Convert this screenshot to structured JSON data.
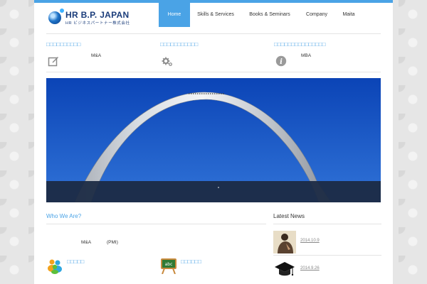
{
  "header": {
    "logo_title": "HR B.P. JAPAN",
    "logo_subtitle": "HR ビジネスパートナー株式会社",
    "accent_color": "#4aa3e6"
  },
  "nav": {
    "items": [
      {
        "label": "Home",
        "active": true
      },
      {
        "label": "Skills & Services",
        "active": false
      },
      {
        "label": "Books & Seminars",
        "active": false
      },
      {
        "label": "Company",
        "active": false
      },
      {
        "label": "Maita",
        "active": false
      }
    ]
  },
  "features": [
    {
      "title": "□□□□□□□□□□",
      "text": "M&A",
      "icon": "edit-icon"
    },
    {
      "title": "□□□□□□□□□□□",
      "text": "",
      "icon": "gear-icon"
    },
    {
      "title": "□□□□□□□□□□□□□□□",
      "text": "MBA",
      "icon": "info-icon"
    }
  ],
  "hero": {
    "image": "gateway-arch-photo"
  },
  "who": {
    "heading": "Who We Are?",
    "text1": "M&A",
    "text2": "(PMI)",
    "items": [
      {
        "title": "□□□□□",
        "icon": "people-icon"
      },
      {
        "title": "□□□□□□",
        "icon": "chalkboard-icon"
      }
    ]
  },
  "news": {
    "heading": "Latest News",
    "items": [
      {
        "date": "2014.10.9",
        "thumb": "thinking-person-thumbnail"
      },
      {
        "date": "2014.9.26",
        "thumb": "graduation-cap-thumbnail"
      }
    ]
  }
}
